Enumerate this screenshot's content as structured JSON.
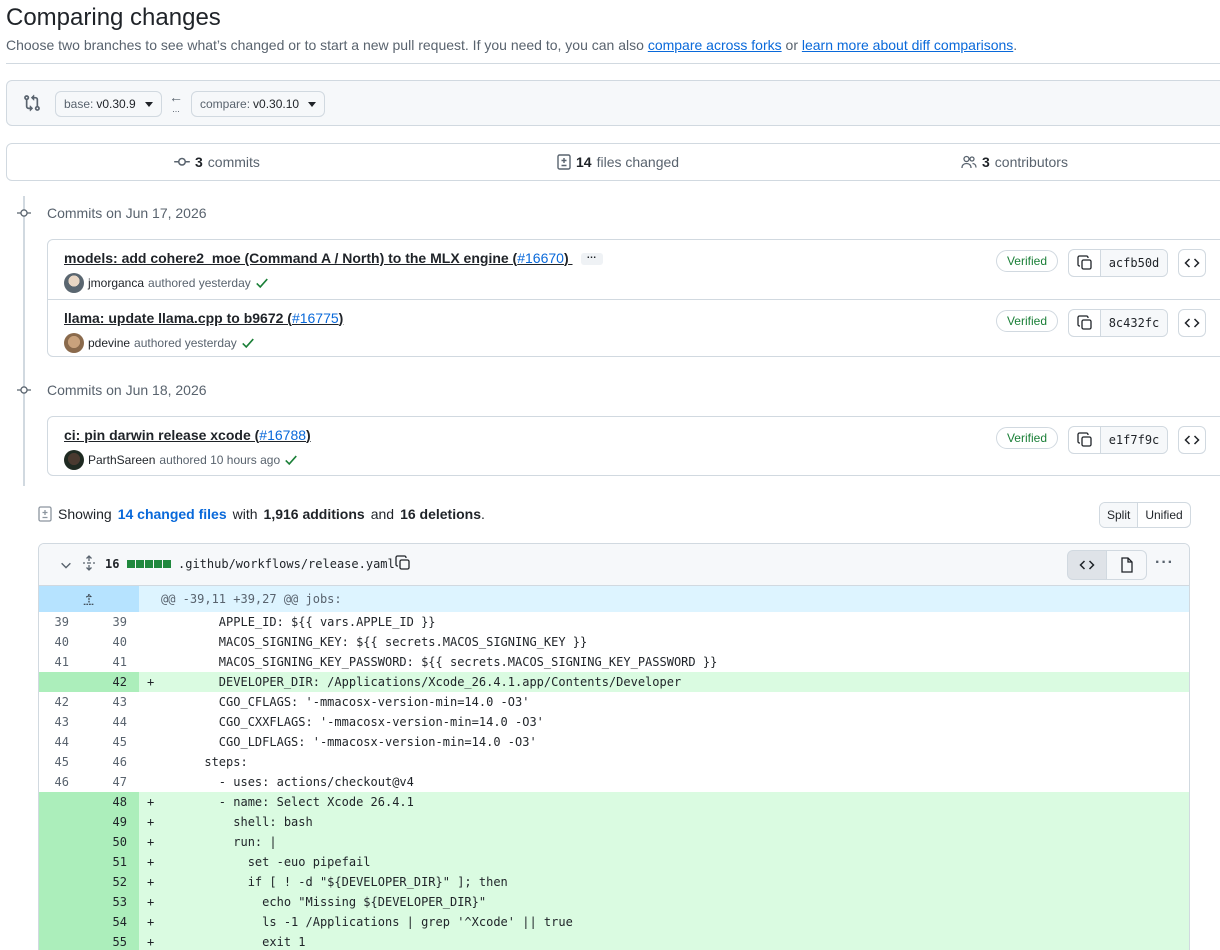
{
  "header": {
    "title": "Comparing changes",
    "subtitle_prefix": "Choose two branches to see what’s changed or to start a new pull request. If you need to, you can also",
    "link_forks": "compare across forks",
    "or": "or",
    "link_learn": "learn more about diff comparisons",
    "period": "."
  },
  "range": {
    "base_label": "base:",
    "base_value": "v0.30.9",
    "compare_label": "compare:",
    "compare_value": "v0.30.10",
    "arrow": "←",
    "dots": "..."
  },
  "summary": {
    "commits_count": "3",
    "commits_label": "commits",
    "files_count": "14",
    "files_label": "files changed",
    "contributors_count": "3",
    "contributors_label": "contributors"
  },
  "groups": [
    {
      "date": "Commits on Jun 17, 2026",
      "commits": [
        {
          "title": "models: add cohere2_moe (Command A / North) to the MLX engine (",
          "pr": "#16670",
          "close": ")",
          "ellipsis": "…",
          "author": "jmorganca",
          "meta": "authored yesterday",
          "verified": "Verified",
          "sha": "acfb50d"
        },
        {
          "title": "llama: update llama.cpp to b9672 (",
          "pr": "#16775",
          "close": ")",
          "author": "pdevine",
          "meta": "authored yesterday",
          "verified": "Verified",
          "sha": "8c432fc"
        }
      ]
    },
    {
      "date": "Commits on Jun 18, 2026",
      "commits": [
        {
          "title": "ci: pin darwin release xcode (",
          "pr": "#16788",
          "close": ")",
          "author": "ParthSareen",
          "meta": "authored 10 hours ago",
          "verified": "Verified",
          "sha": "e1f7f9c"
        }
      ]
    }
  ],
  "showing": {
    "prefix": "Showing",
    "files_link": "14 changed files",
    "with": "with",
    "additions": "1,916 additions",
    "and": "and",
    "deletions": "16 deletions",
    "period": "."
  },
  "view_toggle": {
    "split": "Split",
    "unified": "Unified"
  },
  "file": {
    "count": "16",
    "path": ".github/workflows/release.yaml",
    "hunk": "@@ -39,11 +39,27 @@ jobs:",
    "lines": [
      {
        "o": "39",
        "n": "39",
        "t": "ctx",
        "code": "        APPLE_ID: ${{ vars.APPLE_ID }}"
      },
      {
        "o": "40",
        "n": "40",
        "t": "ctx",
        "code": "        MACOS_SIGNING_KEY: ${{ secrets.MACOS_SIGNING_KEY }}"
      },
      {
        "o": "41",
        "n": "41",
        "t": "ctx",
        "code": "        MACOS_SIGNING_KEY_PASSWORD: ${{ secrets.MACOS_SIGNING_KEY_PASSWORD }}"
      },
      {
        "o": "",
        "n": "42",
        "t": "add",
        "code": "        DEVELOPER_DIR: /Applications/Xcode_26.4.1.app/Contents/Developer"
      },
      {
        "o": "42",
        "n": "43",
        "t": "ctx",
        "code": "        CGO_CFLAGS: '-mmacosx-version-min=14.0 -O3'"
      },
      {
        "o": "43",
        "n": "44",
        "t": "ctx",
        "code": "        CGO_CXXFLAGS: '-mmacosx-version-min=14.0 -O3'"
      },
      {
        "o": "44",
        "n": "45",
        "t": "ctx",
        "code": "        CGO_LDFLAGS: '-mmacosx-version-min=14.0 -O3'"
      },
      {
        "o": "45",
        "n": "46",
        "t": "ctx",
        "code": "      steps:"
      },
      {
        "o": "46",
        "n": "47",
        "t": "ctx",
        "code": "        - uses: actions/checkout@v4"
      },
      {
        "o": "",
        "n": "48",
        "t": "add",
        "code": "        - name: Select Xcode 26.4.1"
      },
      {
        "o": "",
        "n": "49",
        "t": "add",
        "code": "          shell: bash"
      },
      {
        "o": "",
        "n": "50",
        "t": "add",
        "code": "          run: |"
      },
      {
        "o": "",
        "n": "51",
        "t": "add",
        "code": "            set -euo pipefail"
      },
      {
        "o": "",
        "n": "52",
        "t": "add",
        "code": "            if [ ! -d \"${DEVELOPER_DIR}\" ]; then"
      },
      {
        "o": "",
        "n": "53",
        "t": "add",
        "code": "              echo \"Missing ${DEVELOPER_DIR}\""
      },
      {
        "o": "",
        "n": "54",
        "t": "add",
        "code": "              ls -1 /Applications | grep '^Xcode' || true"
      },
      {
        "o": "",
        "n": "55",
        "t": "add",
        "code": "              exit 1"
      }
    ]
  },
  "colors": {
    "accent": "#0969da",
    "added": "#1f883d",
    "verified": "#1a7f37"
  },
  "icons": [
    "git-compare-icon",
    "arrow-left-icon",
    "commit-icon",
    "file-diff-icon",
    "people-icon",
    "check-icon",
    "copy-icon",
    "code-icon",
    "chevron-down-icon",
    "unfold-icon",
    "file-icon",
    "kebab-horizontal-icon"
  ]
}
